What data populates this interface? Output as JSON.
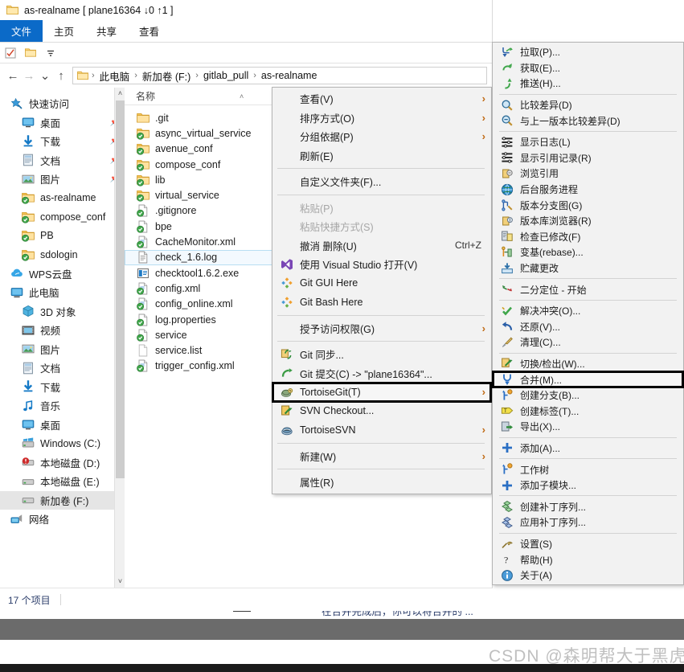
{
  "window": {
    "title": "as-realname [ plane16364 ↓0 ↑1 ]",
    "folder_icon": "folder-icon"
  },
  "ribbon": {
    "tabs": [
      {
        "label": "文件",
        "active": true
      },
      {
        "label": "主页",
        "active": false
      },
      {
        "label": "共享",
        "active": false
      },
      {
        "label": "查看",
        "active": false
      }
    ]
  },
  "quick_access_toolbar": {
    "items": [
      {
        "icon": "properties-check-icon"
      },
      {
        "icon": "new-folder-icon"
      },
      {
        "icon": "customize-dropdown-icon"
      }
    ]
  },
  "address_bar": {
    "back": "←",
    "forward": "→",
    "recent": "⌄",
    "up": "↑",
    "crumbs": [
      "此电脑",
      "新加卷 (F:)",
      "gitlab_pull",
      "as-realname"
    ],
    "separator": "›"
  },
  "nav_pane": {
    "items": [
      {
        "label": "快速访问",
        "icon": "star-pin-icon",
        "indent": 0,
        "pin": false
      },
      {
        "label": "桌面",
        "icon": "desktop-icon",
        "indent": 1,
        "pin": true
      },
      {
        "label": "下载",
        "icon": "download-icon",
        "indent": 1,
        "pin": true
      },
      {
        "label": "文档",
        "icon": "documents-icon",
        "indent": 1,
        "pin": true
      },
      {
        "label": "图片",
        "icon": "pictures-icon",
        "indent": 1,
        "pin": true
      },
      {
        "label": "as-realname",
        "icon": "git-folder-icon",
        "indent": 1,
        "pin": false
      },
      {
        "label": "compose_conf",
        "icon": "git-folder-icon",
        "indent": 1,
        "pin": false
      },
      {
        "label": "PB",
        "icon": "git-folder-icon",
        "indent": 1,
        "pin": false
      },
      {
        "label": "sdologin",
        "icon": "git-folder-icon",
        "indent": 1,
        "pin": false
      },
      {
        "label": "WPS云盘",
        "icon": "cloud-icon",
        "indent": 0,
        "pin": false
      },
      {
        "label": "此电脑",
        "icon": "this-pc-icon",
        "indent": 0,
        "pin": false
      },
      {
        "label": "3D 对象",
        "icon": "3d-objects-icon",
        "indent": 1,
        "pin": false
      },
      {
        "label": "视频",
        "icon": "videos-icon",
        "indent": 1,
        "pin": false
      },
      {
        "label": "图片",
        "icon": "pictures-icon",
        "indent": 1,
        "pin": false
      },
      {
        "label": "文档",
        "icon": "documents-icon",
        "indent": 1,
        "pin": false
      },
      {
        "label": "下载",
        "icon": "download-icon",
        "indent": 1,
        "pin": false
      },
      {
        "label": "音乐",
        "icon": "music-icon",
        "indent": 1,
        "pin": false
      },
      {
        "label": "桌面",
        "icon": "desktop-icon",
        "indent": 1,
        "pin": false
      },
      {
        "label": "Windows (C:)",
        "icon": "windows-drive-icon",
        "indent": 1,
        "pin": false
      },
      {
        "label": "本地磁盘 (D:)",
        "icon": "drive-alert-icon",
        "indent": 1,
        "pin": false
      },
      {
        "label": "本地磁盘 (E:)",
        "icon": "drive-icon",
        "indent": 1,
        "pin": false
      },
      {
        "label": "新加卷 (F:)",
        "icon": "drive-icon",
        "indent": 1,
        "pin": false,
        "selected": true
      },
      {
        "label": "网络",
        "icon": "network-icon",
        "indent": 0,
        "pin": false
      }
    ]
  },
  "file_list": {
    "column_header": "名称",
    "rows": [
      {
        "name": ".git",
        "icon": "folder-plain-icon"
      },
      {
        "name": "async_virtual_service",
        "icon": "git-folder-icon"
      },
      {
        "name": "avenue_conf",
        "icon": "git-folder-icon"
      },
      {
        "name": "compose_conf",
        "icon": "git-folder-icon"
      },
      {
        "name": "lib",
        "icon": "git-folder-icon"
      },
      {
        "name": "virtual_service",
        "icon": "git-folder-icon"
      },
      {
        "name": ".gitignore",
        "icon": "git-file-icon"
      },
      {
        "name": "bpe",
        "icon": "git-file-icon"
      },
      {
        "name": "CacheMonitor.xml",
        "icon": "git-xml-icon"
      },
      {
        "name": "check_1.6.log",
        "icon": "log-file-icon",
        "selected": true
      },
      {
        "name": "checktool1.6.2.exe",
        "icon": "exe-file-icon"
      },
      {
        "name": "config.xml",
        "icon": "git-xml-icon"
      },
      {
        "name": "config_online.xml",
        "icon": "git-xml-icon"
      },
      {
        "name": "log.properties",
        "icon": "git-file-icon"
      },
      {
        "name": "service",
        "icon": "git-file-icon"
      },
      {
        "name": "service.list",
        "icon": "plain-file-icon"
      },
      {
        "name": "trigger_config.xml",
        "icon": "git-xml-icon"
      }
    ]
  },
  "status_bar": {
    "item_count": "17 个项目"
  },
  "context_menu": {
    "items": [
      {
        "label": "查看(V)",
        "icon": null,
        "submenu": true
      },
      {
        "label": "排序方式(O)",
        "icon": null,
        "submenu": true
      },
      {
        "label": "分组依据(P)",
        "icon": null,
        "submenu": true
      },
      {
        "label": "刷新(E)",
        "icon": null
      },
      {
        "separator": true
      },
      {
        "label": "自定义文件夹(F)...",
        "icon": null
      },
      {
        "separator": true
      },
      {
        "label": "粘贴(P)",
        "icon": null,
        "disabled": true
      },
      {
        "label": "粘贴快捷方式(S)",
        "icon": null,
        "disabled": true
      },
      {
        "label": "撤消 删除(U)",
        "icon": null,
        "accel": "Ctrl+Z"
      },
      {
        "label": "使用 Visual Studio 打开(V)",
        "icon": "visual-studio-icon"
      },
      {
        "label": "Git GUI Here",
        "icon": "git-logo-icon"
      },
      {
        "label": "Git Bash Here",
        "icon": "git-logo-icon"
      },
      {
        "separator": true
      },
      {
        "label": "授予访问权限(G)",
        "icon": null,
        "submenu": true
      },
      {
        "separator": true
      },
      {
        "label": "Git 同步...",
        "icon": "git-sync-icon"
      },
      {
        "label": "Git 提交(C) -> \"plane16364\"...",
        "icon": "git-commit-icon"
      },
      {
        "label": "TortoiseGit(T)",
        "icon": "tortoisegit-icon",
        "submenu": true,
        "highlighted": true
      },
      {
        "label": "SVN Checkout...",
        "icon": "svn-checkout-icon"
      },
      {
        "label": "TortoiseSVN",
        "icon": "tortoisesvn-icon",
        "submenu": true
      },
      {
        "separator": true
      },
      {
        "label": "新建(W)",
        "icon": null,
        "submenu": true
      },
      {
        "separator": true
      },
      {
        "label": "属性(R)",
        "icon": null
      }
    ]
  },
  "tortoisegit_menu": {
    "items": [
      {
        "label": "拉取(P)...",
        "icon": "pull-icon"
      },
      {
        "label": "获取(E)...",
        "icon": "fetch-icon"
      },
      {
        "label": "推送(H)...",
        "icon": "push-icon"
      },
      {
        "separator": true
      },
      {
        "label": "比较差异(D)",
        "icon": "diff-icon"
      },
      {
        "label": "与上一版本比较差异(D)",
        "icon": "diff-prev-icon"
      },
      {
        "separator": true
      },
      {
        "label": "显示日志(L)",
        "icon": "show-log-icon"
      },
      {
        "label": "显示引用记录(R)",
        "icon": "reflog-icon"
      },
      {
        "label": "浏览引用",
        "icon": "browse-refs-icon"
      },
      {
        "label": "后台服务进程",
        "icon": "daemon-icon"
      },
      {
        "label": "版本分支图(G)",
        "icon": "revision-graph-icon"
      },
      {
        "label": "版本库浏览器(R)",
        "icon": "repo-browser-icon"
      },
      {
        "label": "检查已修改(F)",
        "icon": "check-modifications-icon"
      },
      {
        "label": "变基(rebase)...",
        "icon": "rebase-icon"
      },
      {
        "label": "贮藏更改",
        "icon": "stash-icon"
      },
      {
        "separator": true
      },
      {
        "label": "二分定位 - 开始",
        "icon": "bisect-icon"
      },
      {
        "separator": true
      },
      {
        "label": "解决冲突(O)...",
        "icon": "resolve-icon"
      },
      {
        "label": "还原(V)...",
        "icon": "revert-icon"
      },
      {
        "label": "清理(C)...",
        "icon": "cleanup-icon"
      },
      {
        "separator": true
      },
      {
        "label": "切换/检出(W)...",
        "icon": "switch-checkout-icon"
      },
      {
        "label": "合并(M)...",
        "icon": "merge-icon",
        "highlighted": true
      },
      {
        "label": "创建分支(B)...",
        "icon": "create-branch-icon"
      },
      {
        "label": "创建标签(T)...",
        "icon": "create-tag-icon"
      },
      {
        "label": "导出(X)...",
        "icon": "export-icon"
      },
      {
        "separator": true
      },
      {
        "label": "添加(A)...",
        "icon": "add-icon"
      },
      {
        "separator": true
      },
      {
        "label": "工作树",
        "icon": "worktree-icon"
      },
      {
        "label": "添加子模块...",
        "icon": "add-submodule-icon"
      },
      {
        "separator": true
      },
      {
        "label": "创建补丁序列...",
        "icon": "create-patch-icon"
      },
      {
        "label": "应用补丁序列...",
        "icon": "apply-patch-icon"
      },
      {
        "separator": true
      },
      {
        "label": "设置(S)",
        "icon": "settings-icon"
      },
      {
        "label": "帮助(H)",
        "icon": "help-icon"
      },
      {
        "label": "关于(A)",
        "icon": "about-icon"
      }
    ]
  },
  "background_page": {
    "partial_text": "在合并完成后，你可以将合并的 ..."
  },
  "watermark": {
    "text": "CSDN @森明帮大于黑虎帮"
  },
  "colors": {
    "accent": "#0b6ac8",
    "menu_bg": "#f2f2f2",
    "highlight_outline": "#000000",
    "selection": "#e5e5e5"
  }
}
